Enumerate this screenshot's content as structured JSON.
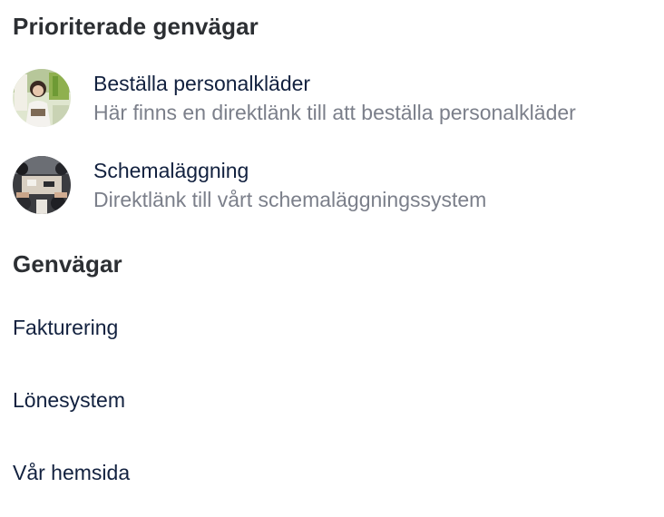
{
  "prioritized": {
    "title": "Prioriterade genvägar",
    "items": [
      {
        "title": "Beställa personalkläder",
        "description": "Här finns en direktlänk till att beställa personalkläder",
        "image": "clothing-store-photo"
      },
      {
        "title": "Schemaläggning",
        "description": "Direktlänk till vårt schemaläggningssystem",
        "image": "team-meeting-photo"
      }
    ]
  },
  "shortcuts": {
    "title": "Genvägar",
    "links": [
      "Fakturering",
      "Lönesystem",
      "Vår hemsida"
    ]
  },
  "colors": {
    "heading": "#2c2f33",
    "link_text": "#12213f",
    "description_text": "#7b7f8a",
    "background": "#ffffff"
  }
}
